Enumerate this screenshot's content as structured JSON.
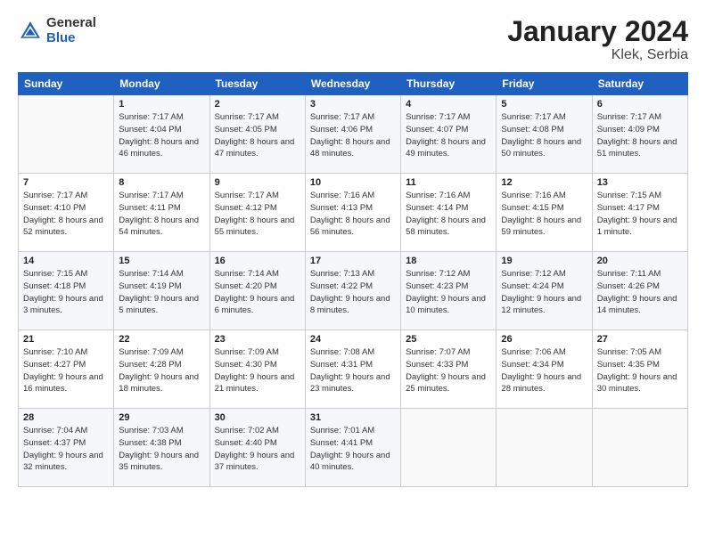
{
  "header": {
    "logo_general": "General",
    "logo_blue": "Blue",
    "month_year": "January 2024",
    "location": "Klek, Serbia"
  },
  "days_of_week": [
    "Sunday",
    "Monday",
    "Tuesday",
    "Wednesday",
    "Thursday",
    "Friday",
    "Saturday"
  ],
  "weeks": [
    [
      {
        "num": "",
        "sunrise": "",
        "sunset": "",
        "daylight": "",
        "empty": true
      },
      {
        "num": "1",
        "sunrise": "Sunrise: 7:17 AM",
        "sunset": "Sunset: 4:04 PM",
        "daylight": "Daylight: 8 hours and 46 minutes."
      },
      {
        "num": "2",
        "sunrise": "Sunrise: 7:17 AM",
        "sunset": "Sunset: 4:05 PM",
        "daylight": "Daylight: 8 hours and 47 minutes."
      },
      {
        "num": "3",
        "sunrise": "Sunrise: 7:17 AM",
        "sunset": "Sunset: 4:06 PM",
        "daylight": "Daylight: 8 hours and 48 minutes."
      },
      {
        "num": "4",
        "sunrise": "Sunrise: 7:17 AM",
        "sunset": "Sunset: 4:07 PM",
        "daylight": "Daylight: 8 hours and 49 minutes."
      },
      {
        "num": "5",
        "sunrise": "Sunrise: 7:17 AM",
        "sunset": "Sunset: 4:08 PM",
        "daylight": "Daylight: 8 hours and 50 minutes."
      },
      {
        "num": "6",
        "sunrise": "Sunrise: 7:17 AM",
        "sunset": "Sunset: 4:09 PM",
        "daylight": "Daylight: 8 hours and 51 minutes."
      }
    ],
    [
      {
        "num": "7",
        "sunrise": "Sunrise: 7:17 AM",
        "sunset": "Sunset: 4:10 PM",
        "daylight": "Daylight: 8 hours and 52 minutes."
      },
      {
        "num": "8",
        "sunrise": "Sunrise: 7:17 AM",
        "sunset": "Sunset: 4:11 PM",
        "daylight": "Daylight: 8 hours and 54 minutes."
      },
      {
        "num": "9",
        "sunrise": "Sunrise: 7:17 AM",
        "sunset": "Sunset: 4:12 PM",
        "daylight": "Daylight: 8 hours and 55 minutes."
      },
      {
        "num": "10",
        "sunrise": "Sunrise: 7:16 AM",
        "sunset": "Sunset: 4:13 PM",
        "daylight": "Daylight: 8 hours and 56 minutes."
      },
      {
        "num": "11",
        "sunrise": "Sunrise: 7:16 AM",
        "sunset": "Sunset: 4:14 PM",
        "daylight": "Daylight: 8 hours and 58 minutes."
      },
      {
        "num": "12",
        "sunrise": "Sunrise: 7:16 AM",
        "sunset": "Sunset: 4:15 PM",
        "daylight": "Daylight: 8 hours and 59 minutes."
      },
      {
        "num": "13",
        "sunrise": "Sunrise: 7:15 AM",
        "sunset": "Sunset: 4:17 PM",
        "daylight": "Daylight: 9 hours and 1 minute."
      }
    ],
    [
      {
        "num": "14",
        "sunrise": "Sunrise: 7:15 AM",
        "sunset": "Sunset: 4:18 PM",
        "daylight": "Daylight: 9 hours and 3 minutes."
      },
      {
        "num": "15",
        "sunrise": "Sunrise: 7:14 AM",
        "sunset": "Sunset: 4:19 PM",
        "daylight": "Daylight: 9 hours and 5 minutes."
      },
      {
        "num": "16",
        "sunrise": "Sunrise: 7:14 AM",
        "sunset": "Sunset: 4:20 PM",
        "daylight": "Daylight: 9 hours and 6 minutes."
      },
      {
        "num": "17",
        "sunrise": "Sunrise: 7:13 AM",
        "sunset": "Sunset: 4:22 PM",
        "daylight": "Daylight: 9 hours and 8 minutes."
      },
      {
        "num": "18",
        "sunrise": "Sunrise: 7:12 AM",
        "sunset": "Sunset: 4:23 PM",
        "daylight": "Daylight: 9 hours and 10 minutes."
      },
      {
        "num": "19",
        "sunrise": "Sunrise: 7:12 AM",
        "sunset": "Sunset: 4:24 PM",
        "daylight": "Daylight: 9 hours and 12 minutes."
      },
      {
        "num": "20",
        "sunrise": "Sunrise: 7:11 AM",
        "sunset": "Sunset: 4:26 PM",
        "daylight": "Daylight: 9 hours and 14 minutes."
      }
    ],
    [
      {
        "num": "21",
        "sunrise": "Sunrise: 7:10 AM",
        "sunset": "Sunset: 4:27 PM",
        "daylight": "Daylight: 9 hours and 16 minutes."
      },
      {
        "num": "22",
        "sunrise": "Sunrise: 7:09 AM",
        "sunset": "Sunset: 4:28 PM",
        "daylight": "Daylight: 9 hours and 18 minutes."
      },
      {
        "num": "23",
        "sunrise": "Sunrise: 7:09 AM",
        "sunset": "Sunset: 4:30 PM",
        "daylight": "Daylight: 9 hours and 21 minutes."
      },
      {
        "num": "24",
        "sunrise": "Sunrise: 7:08 AM",
        "sunset": "Sunset: 4:31 PM",
        "daylight": "Daylight: 9 hours and 23 minutes."
      },
      {
        "num": "25",
        "sunrise": "Sunrise: 7:07 AM",
        "sunset": "Sunset: 4:33 PM",
        "daylight": "Daylight: 9 hours and 25 minutes."
      },
      {
        "num": "26",
        "sunrise": "Sunrise: 7:06 AM",
        "sunset": "Sunset: 4:34 PM",
        "daylight": "Daylight: 9 hours and 28 minutes."
      },
      {
        "num": "27",
        "sunrise": "Sunrise: 7:05 AM",
        "sunset": "Sunset: 4:35 PM",
        "daylight": "Daylight: 9 hours and 30 minutes."
      }
    ],
    [
      {
        "num": "28",
        "sunrise": "Sunrise: 7:04 AM",
        "sunset": "Sunset: 4:37 PM",
        "daylight": "Daylight: 9 hours and 32 minutes."
      },
      {
        "num": "29",
        "sunrise": "Sunrise: 7:03 AM",
        "sunset": "Sunset: 4:38 PM",
        "daylight": "Daylight: 9 hours and 35 minutes."
      },
      {
        "num": "30",
        "sunrise": "Sunrise: 7:02 AM",
        "sunset": "Sunset: 4:40 PM",
        "daylight": "Daylight: 9 hours and 37 minutes."
      },
      {
        "num": "31",
        "sunrise": "Sunrise: 7:01 AM",
        "sunset": "Sunset: 4:41 PM",
        "daylight": "Daylight: 9 hours and 40 minutes."
      },
      {
        "num": "",
        "sunrise": "",
        "sunset": "",
        "daylight": "",
        "empty": true
      },
      {
        "num": "",
        "sunrise": "",
        "sunset": "",
        "daylight": "",
        "empty": true
      },
      {
        "num": "",
        "sunrise": "",
        "sunset": "",
        "daylight": "",
        "empty": true
      }
    ]
  ]
}
